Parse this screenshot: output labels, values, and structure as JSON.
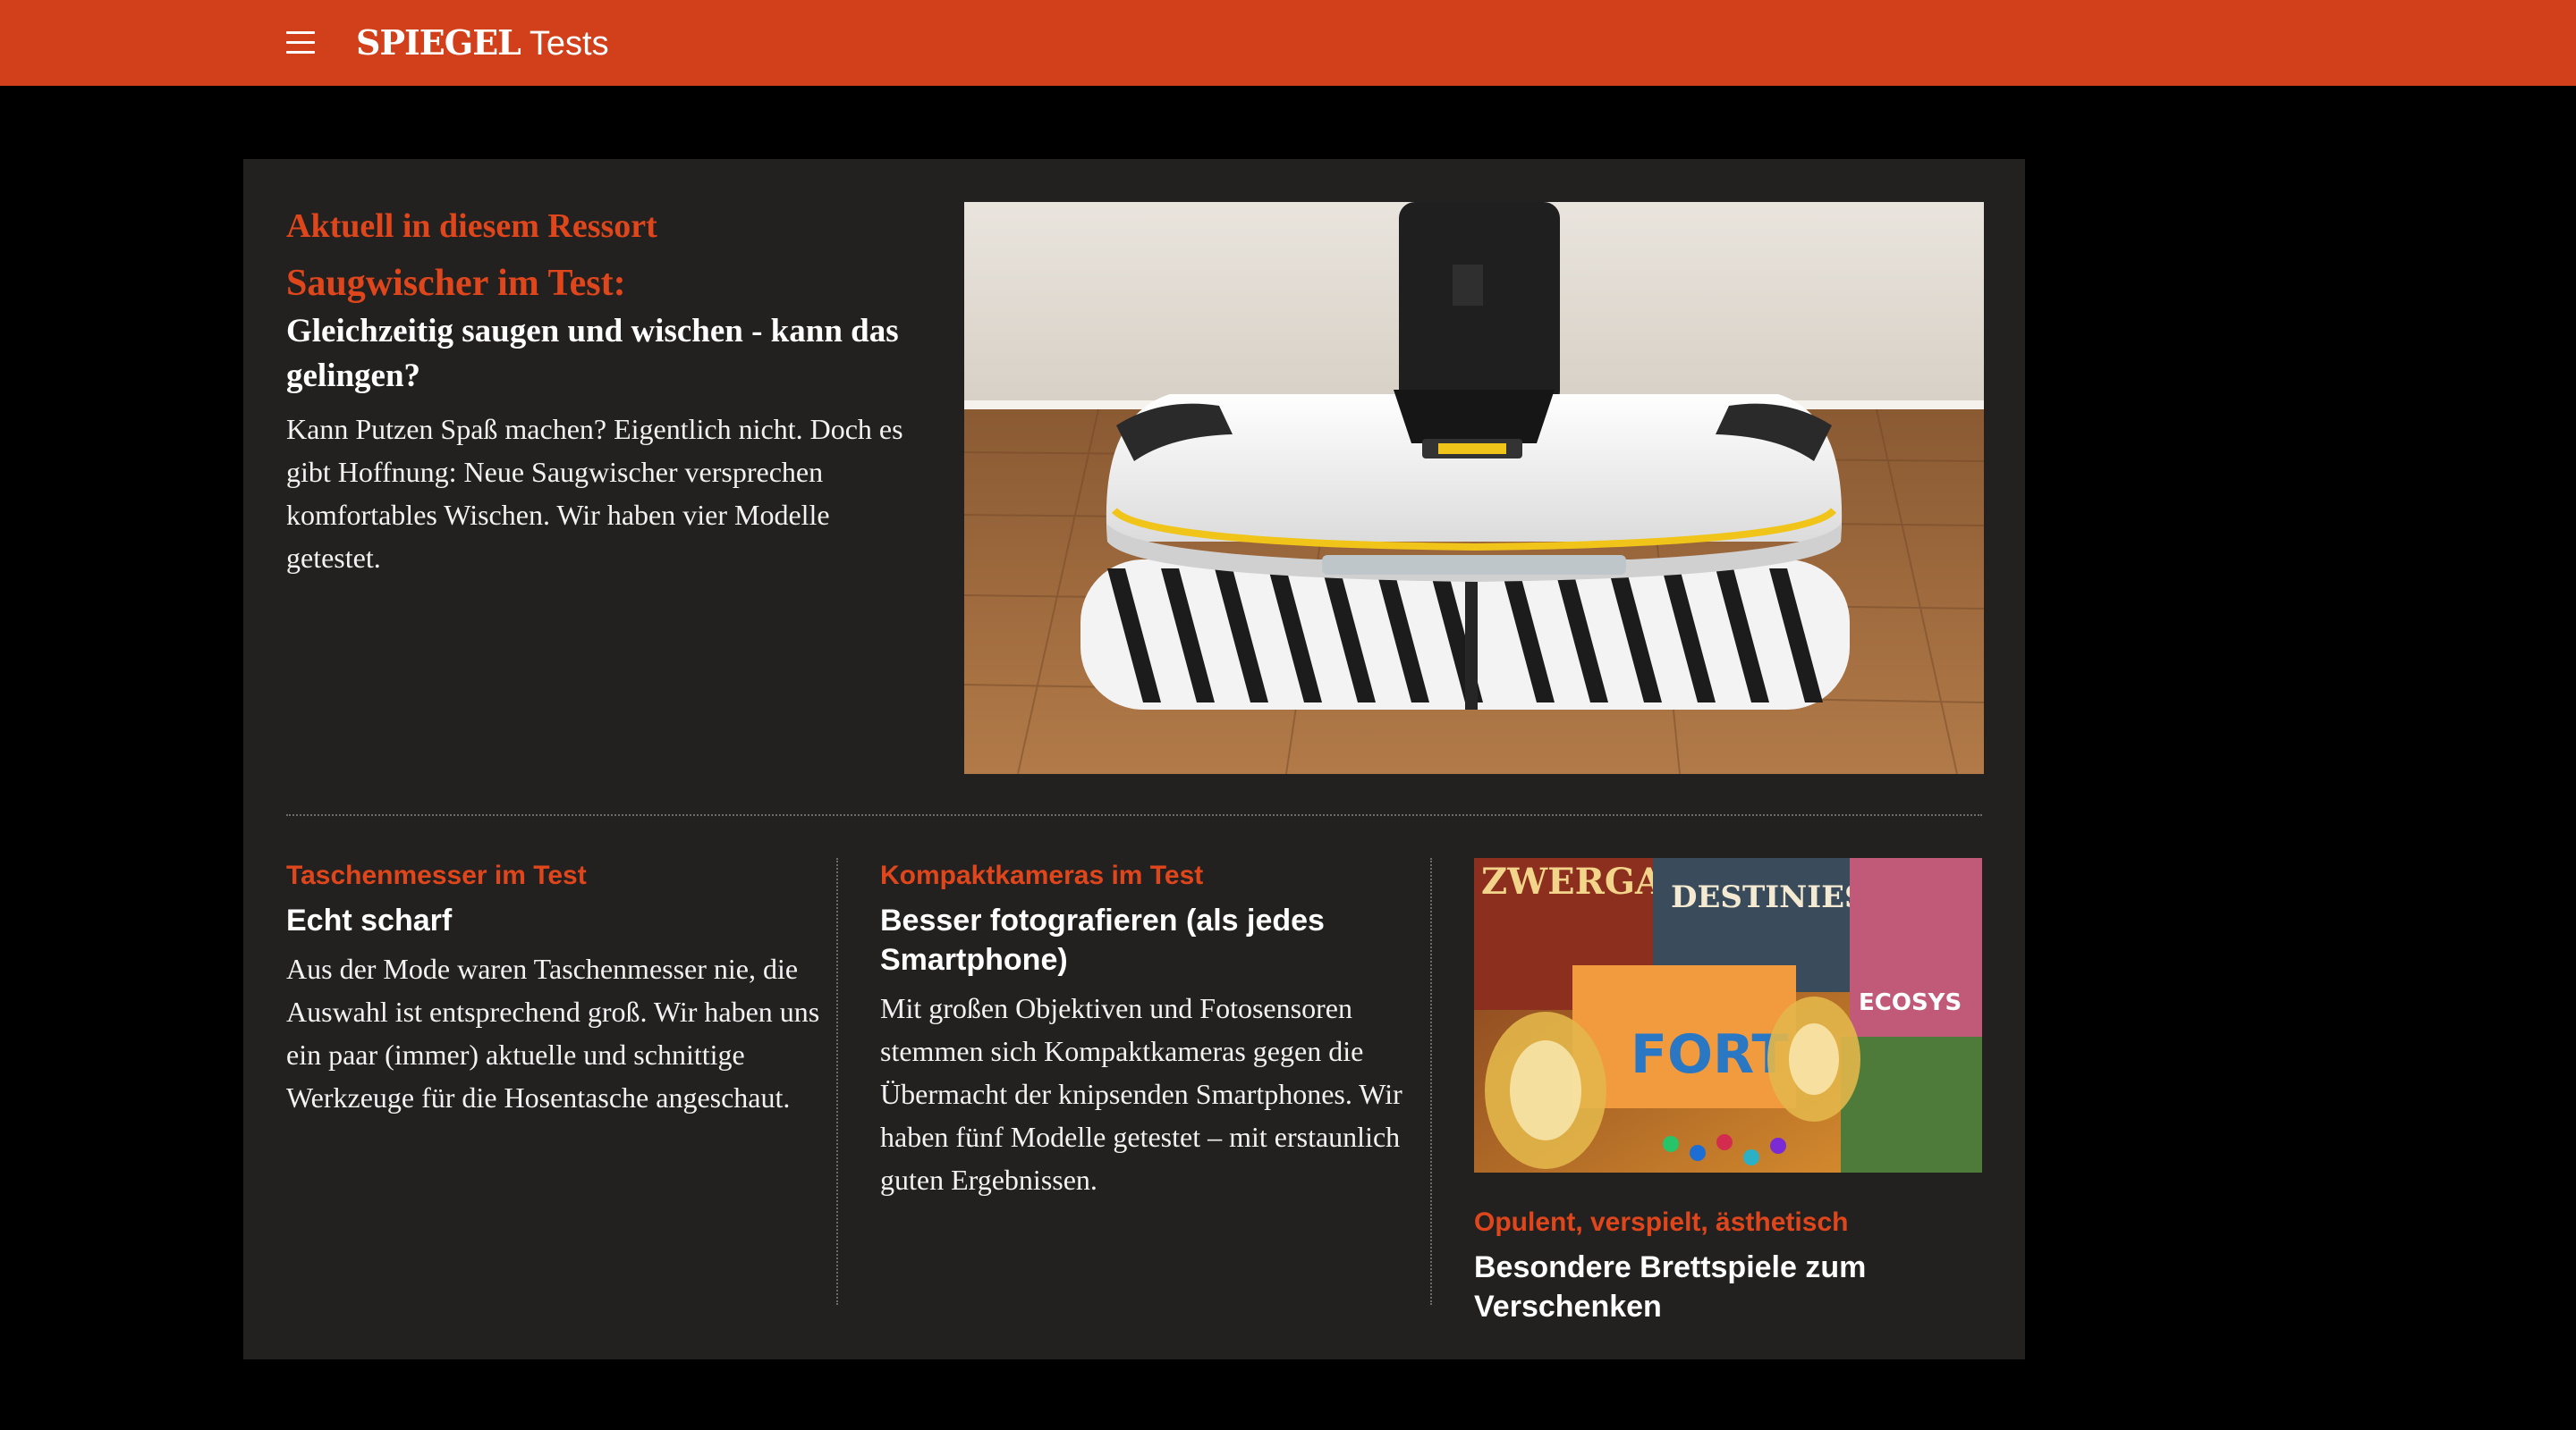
{
  "header": {
    "brand_logo": "SPIEGEL",
    "brand_section": "Tests",
    "background_color": "#d1401a"
  },
  "lead": {
    "ressort_label": "Aktuell in diesem Ressort",
    "kicker": "Saugwischer im Test:",
    "headline": "Gleichzeitig saugen und wischen - kann das gelingen?",
    "teaser": "Kann Putzen Spaß machen? Eigentlich nicht. Doch es gibt Hoffnung: Neue Saugwischer versprechen komfortables Wischen. Wir haben vier Modelle getestet."
  },
  "articles": [
    {
      "kicker": "Taschenmesser im Test",
      "headline": "Echt scharf",
      "teaser": "Aus der Mode waren Taschenmesser nie, die Auswahl ist entsprechend groß. Wir haben uns ein paar (immer) aktuelle und schnittige Werkzeuge für die Hosentasche angeschaut."
    },
    {
      "kicker": "Kompaktkameras im Test",
      "headline": "Besser fotografieren (als jedes Smartphone)",
      "teaser": "Mit großen Objektiven und Fotosensoren stemmen sich Kompaktkameras gegen die Übermacht der knipsenden Smartphones. Wir haben fünf Modelle getestet – mit erstaunlich guten Ergebnissen."
    },
    {
      "kicker": "Opulent, verspielt, ästhetisch",
      "headline": "Besondere Brettspiele zum Verschenken",
      "image_box_titles": [
        "ZWERGAR",
        "DESTINIES",
        "FORT",
        "ECOSYS"
      ]
    }
  ],
  "colors": {
    "accent": "#e0461b",
    "panel": "#222120",
    "page_background": "#000000"
  }
}
